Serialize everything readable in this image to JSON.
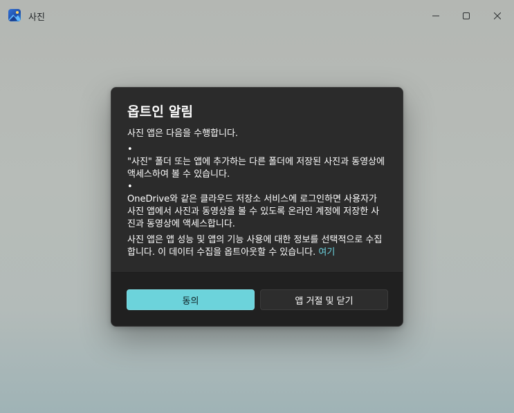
{
  "window": {
    "title": "사진",
    "controls": {
      "minimize_icon": "minimize-icon",
      "maximize_icon": "maximize-icon",
      "close_icon": "close-icon"
    }
  },
  "dialog": {
    "title": "옵트인 알림",
    "intro": "사진 앱은 다음을 수행합니다.",
    "bullets": [
      {
        "marker": "•",
        "text": "\"사진\" 폴더 또는 앱에 추가하는 다른 폴더에 저장된 사진과 동영상에 액세스하여 볼 수 있습니다."
      },
      {
        "marker": "•",
        "text": "OneDrive와 같은 클라우드 저장소 서비스에 로그인하면 사용자가 사진 앱에서 사진과 동영상을 볼 수 있도록 온라인 계정에 저장한 사진과 동영상에 액세스합니다."
      }
    ],
    "closing": "사진 앱은 앱 성능 및 앱의 기능 사용에 대한 정보를 선택적으로 수집합니다. 이 데이터 수집을 옵트아웃할 수 있습니다.",
    "link_label": "여기",
    "buttons": {
      "agree": "동의",
      "reject_close": "앱 거절 및 닫기"
    }
  },
  "colors": {
    "accent": "#6cd3db",
    "link": "#6cd2de",
    "dialog_bg": "#2b2b2b",
    "footer_bg": "#202020"
  }
}
